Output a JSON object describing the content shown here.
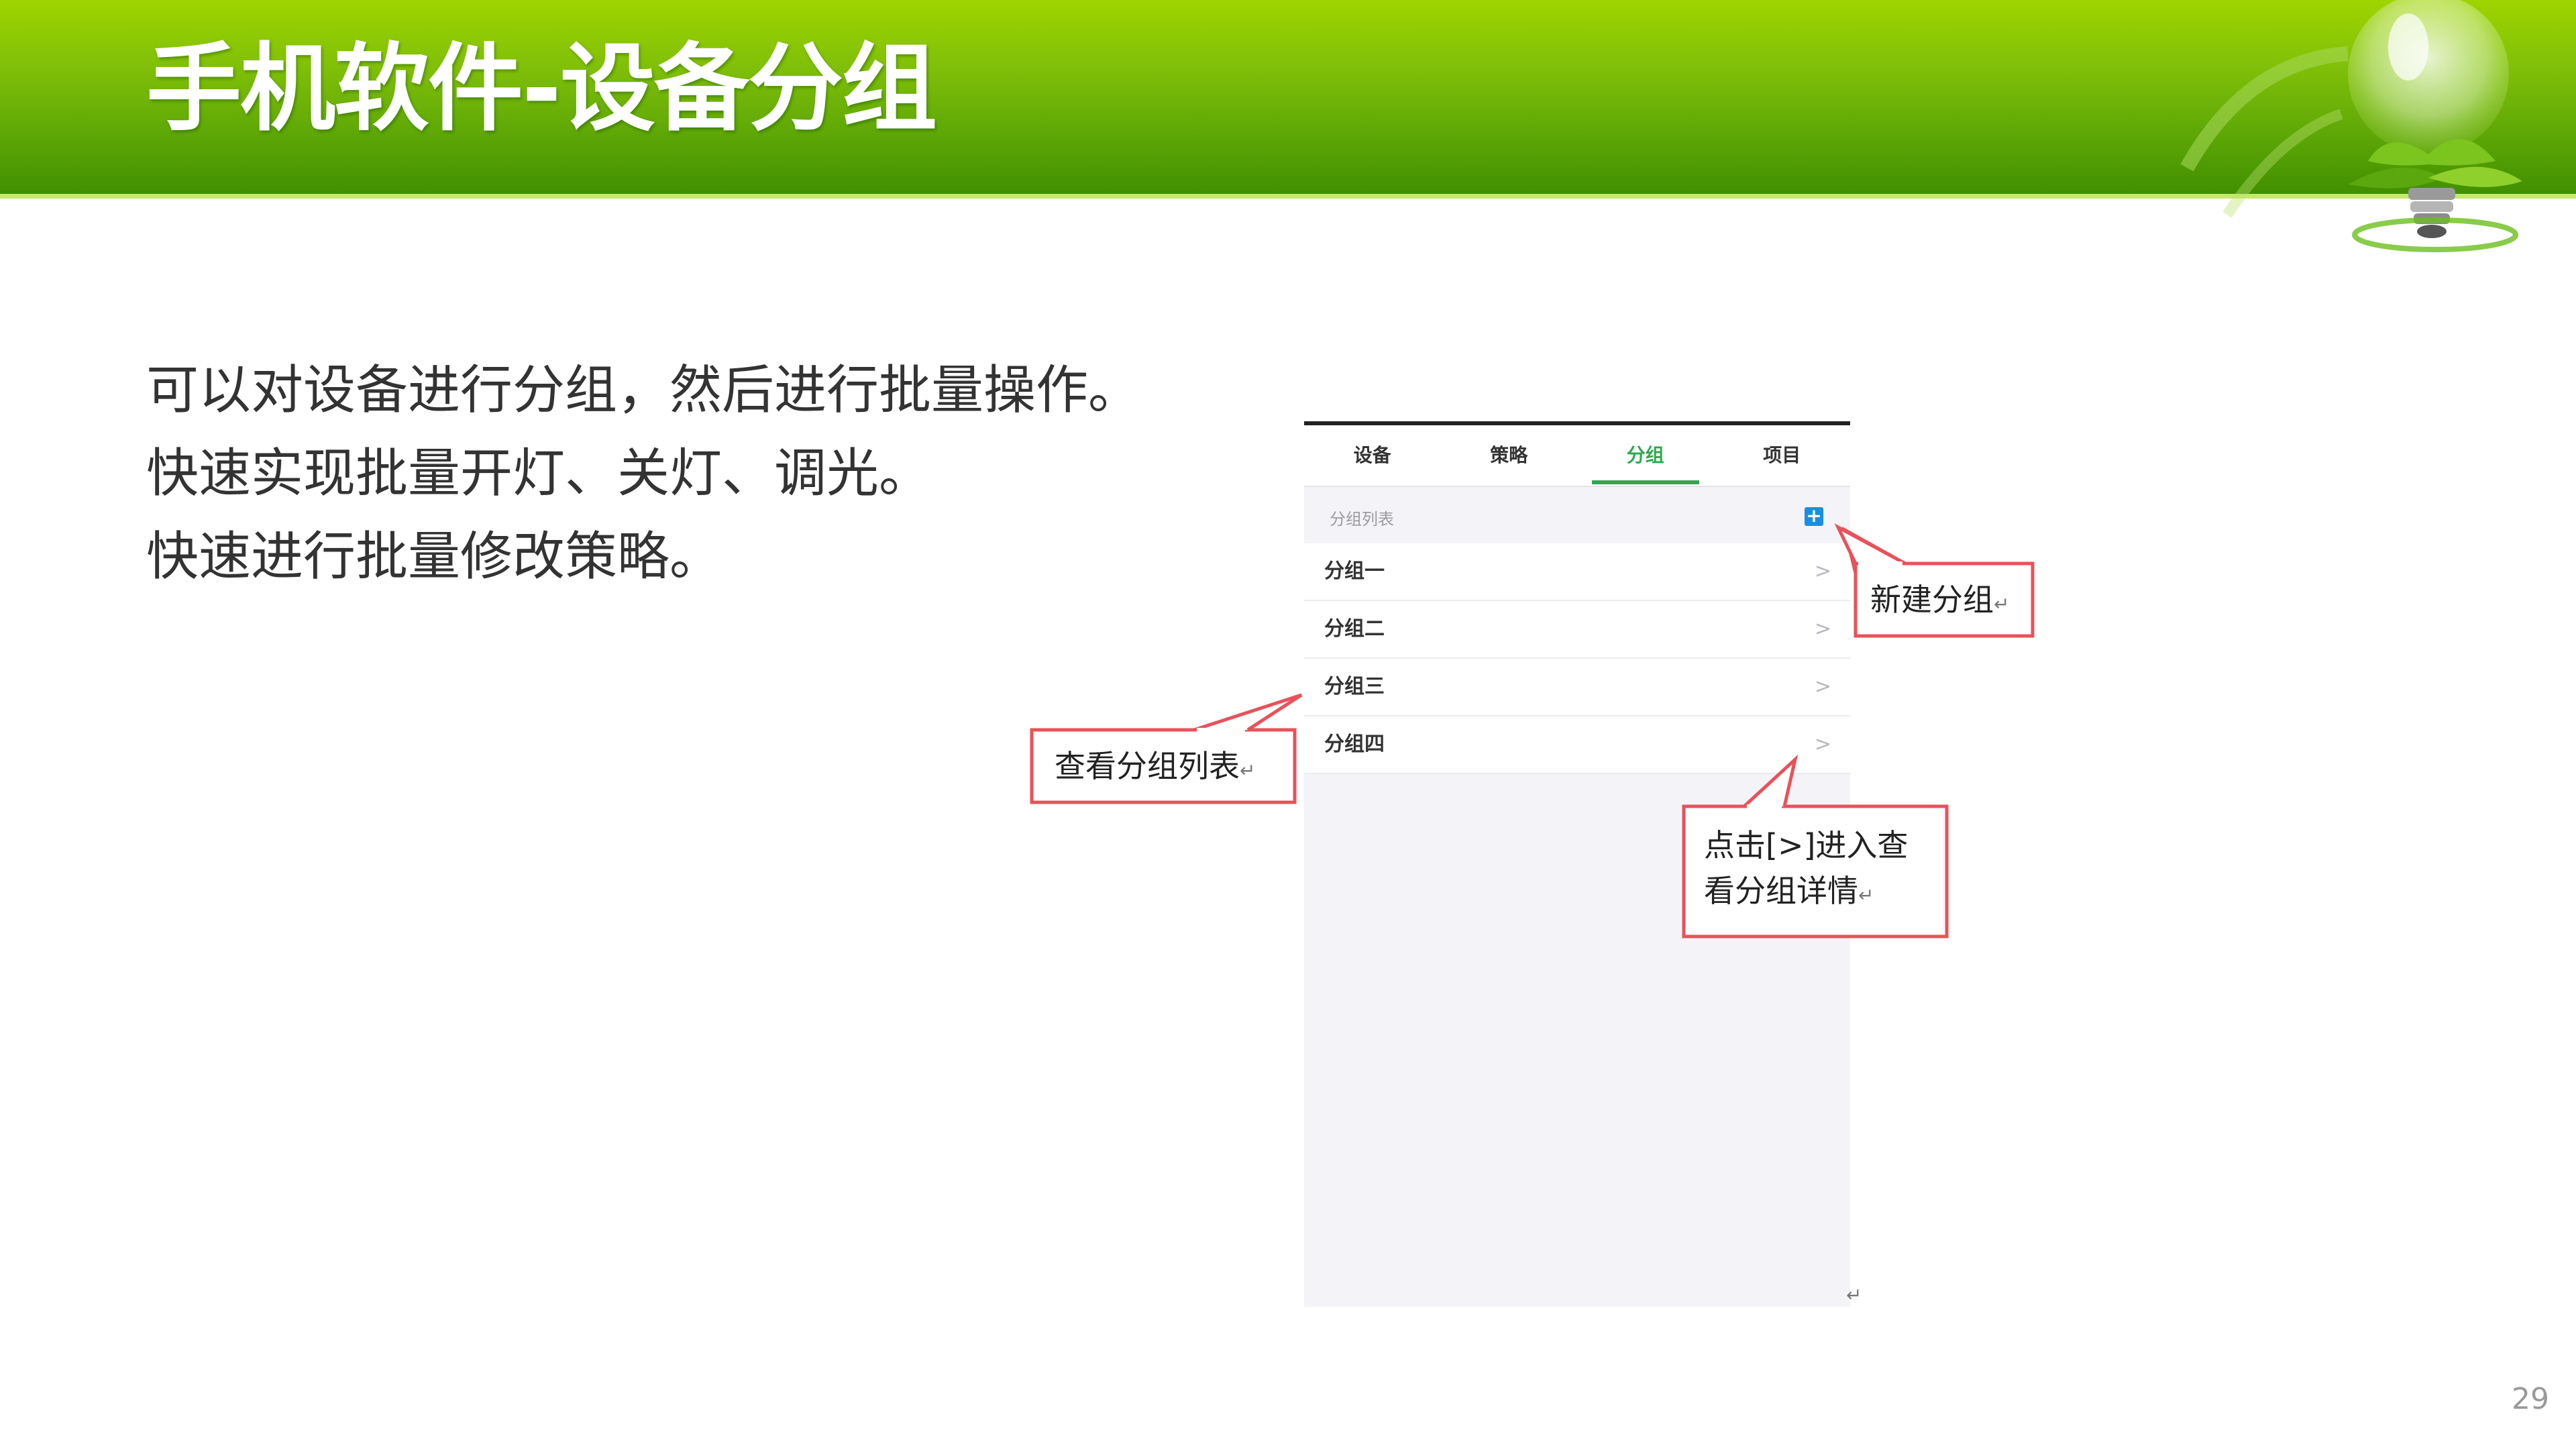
{
  "slide": {
    "title": "手机软件-设备分组",
    "page_number": "29"
  },
  "description": [
    "可以对设备进行分组，然后进行批量操作。",
    "快速实现批量开灯、关灯、调光。",
    "快速进行批量修改策略。"
  ],
  "phone": {
    "tabs": [
      {
        "label": "设备",
        "active": false
      },
      {
        "label": "策略",
        "active": false
      },
      {
        "label": "分组",
        "active": true
      },
      {
        "label": "项目",
        "active": false
      }
    ],
    "section_label": "分组列表",
    "add_button": "+",
    "groups": [
      {
        "name": "分组一",
        "chevron": ">"
      },
      {
        "name": "分组二",
        "chevron": ">"
      },
      {
        "name": "分组三",
        "chevron": ">"
      },
      {
        "name": "分组四",
        "chevron": ">"
      }
    ],
    "return_mark": "↵"
  },
  "callouts": {
    "new_group": "新建分组",
    "view_list": "查看分组列表",
    "detail_line1": "点击[>]进入查",
    "detail_line2": "看分组详情",
    "return_mark": "↵"
  },
  "colors": {
    "banner_green": "#6cb20a",
    "active_tab": "#2fa84f",
    "callout_border": "#e8525a",
    "add_button": "#1a8fe0"
  }
}
